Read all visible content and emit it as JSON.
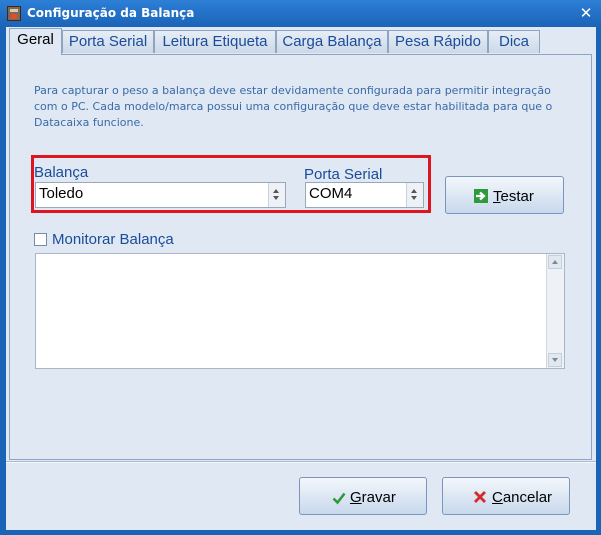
{
  "window": {
    "title": "Configuração da Balança",
    "close_glyph": "✕"
  },
  "tabs": [
    {
      "label": "Geral",
      "active": true
    },
    {
      "label": "Porta Serial",
      "active": false
    },
    {
      "label": "Leitura Etiqueta",
      "active": false
    },
    {
      "label": "Carga Balança",
      "active": false
    },
    {
      "label": "Pesa Rápido",
      "active": false
    },
    {
      "label": "Dica",
      "active": false
    }
  ],
  "info_text": "Para capturar o peso a balança deve estar devidamente configurada para permitir integração com o PC. Cada modelo/marca possui uma configuração que deve estar habilitada para que o Datacaixa funcione.",
  "balanca": {
    "label": "Balança",
    "value": "Toledo"
  },
  "porta_serial": {
    "label": "Porta Serial",
    "value": "COM4"
  },
  "testar_button": {
    "mnemonic": "T",
    "rest": "estar",
    "icon": "arrow-right-icon"
  },
  "monitor": {
    "label": "Monitorar Balança",
    "checked": false
  },
  "memo": {
    "text": ""
  },
  "gravar_button": {
    "mnemonic": "G",
    "rest": "ravar",
    "icon": "check-icon"
  },
  "cancelar_button": {
    "mnemonic": "C",
    "rest": "ancelar",
    "icon": "x-icon"
  },
  "colors": {
    "highlight": "#e0141e",
    "titlebar": "#1a64b8",
    "link_text": "#1a4c9a"
  }
}
